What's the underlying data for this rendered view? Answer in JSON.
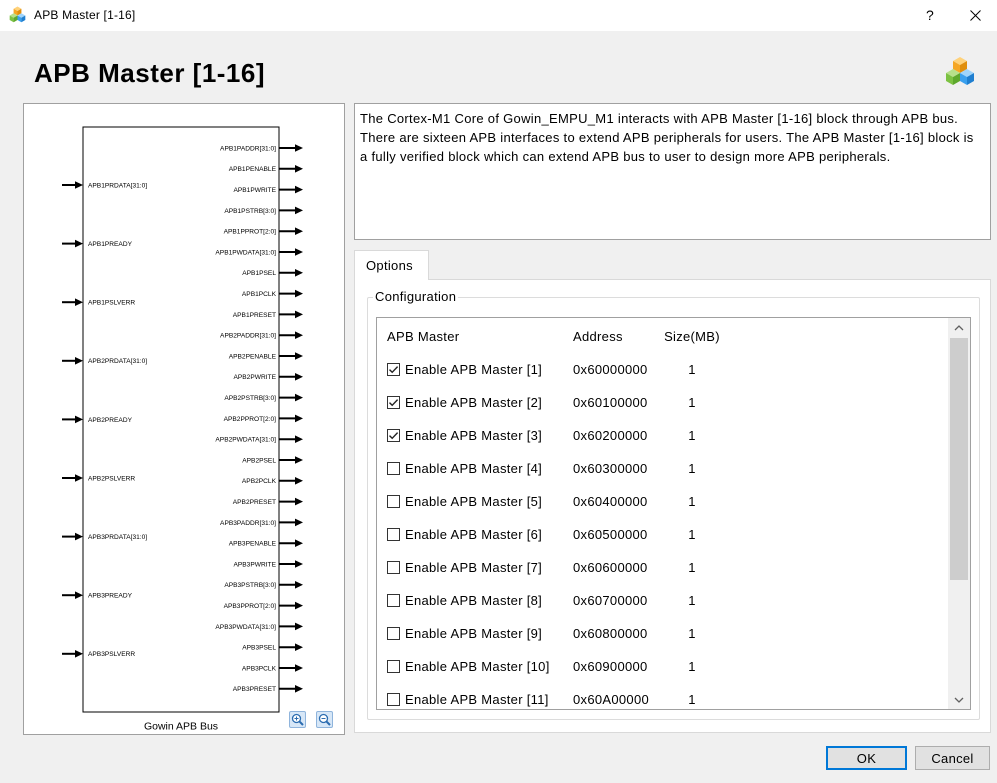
{
  "window": {
    "title": "APB Master [1-16]",
    "help_label": "?"
  },
  "header": {
    "title": "APB Master [1-16]"
  },
  "icons": {
    "app": "cube-stack-icon",
    "header": "cube-stack-icon",
    "close": "close-icon",
    "zoom_in": "zoom-in-icon",
    "zoom_out": "zoom-out-icon",
    "scroll_up": "chevron-up-icon",
    "scroll_down": "chevron-down-icon",
    "check": "checkmark-icon"
  },
  "colors": {
    "accent": "#0078d7"
  },
  "diagram": {
    "caption": "Gowin APB Bus",
    "inputs": [
      "APB1PRDATA[31:0]",
      "APB1PREADY",
      "APB1PSLVERR",
      "APB2PRDATA[31:0]",
      "APB2PREADY",
      "APB2PSLVERR",
      "APB3PRDATA[31:0]",
      "APB3PREADY",
      "APB3PSLVERR"
    ],
    "outputs": [
      "APB1PADDR[31:0]",
      "APB1PENABLE",
      "APB1PWRITE",
      "APB1PSTRB[3:0]",
      "APB1PPROT[2:0]",
      "APB1PWDATA[31:0]",
      "APB1PSEL",
      "APB1PCLK",
      "APB1PRESET",
      "APB2PADDR[31:0]",
      "APB2PENABLE",
      "APB2PWRITE",
      "APB2PSTRB[3:0]",
      "APB2PPROT[2:0]",
      "APB2PWDATA[31:0]",
      "APB2PSEL",
      "APB2PCLK",
      "APB2PRESET",
      "APB3PADDR[31:0]",
      "APB3PENABLE",
      "APB3PWRITE",
      "APB3PSTRB[3:0]",
      "APB3PPROT[2:0]",
      "APB3PWDATA[31:0]",
      "APB3PSEL",
      "APB3PCLK",
      "APB3PRESET"
    ]
  },
  "description": {
    "lines": [
      "The Cortex-M1 Core of Gowin_EMPU_M1 interacts with APB Master [1-16] block through APB bus.",
      "There are sixteen APB interfaces to extend APB peripherals for users. The APB Master [1-16] block is",
      "a fully verified block which can extend APB bus to user to design more APB peripherals."
    ]
  },
  "tabs": [
    {
      "label": "Options",
      "active": true
    }
  ],
  "configuration": {
    "legend": "Configuration",
    "columns": [
      "APB Master",
      "Address",
      "Size(MB)"
    ],
    "rows": [
      {
        "label": "Enable APB Master [1]",
        "checked": true,
        "address": "0x60000000",
        "size": "1"
      },
      {
        "label": "Enable APB Master [2]",
        "checked": true,
        "address": "0x60100000",
        "size": "1"
      },
      {
        "label": "Enable APB Master [3]",
        "checked": true,
        "address": "0x60200000",
        "size": "1"
      },
      {
        "label": "Enable APB Master [4]",
        "checked": false,
        "address": "0x60300000",
        "size": "1"
      },
      {
        "label": "Enable APB Master [5]",
        "checked": false,
        "address": "0x60400000",
        "size": "1"
      },
      {
        "label": "Enable APB Master [6]",
        "checked": false,
        "address": "0x60500000",
        "size": "1"
      },
      {
        "label": "Enable APB Master [7]",
        "checked": false,
        "address": "0x60600000",
        "size": "1"
      },
      {
        "label": "Enable APB Master [8]",
        "checked": false,
        "address": "0x60700000",
        "size": "1"
      },
      {
        "label": "Enable APB Master [9]",
        "checked": false,
        "address": "0x60800000",
        "size": "1"
      },
      {
        "label": "Enable APB Master [10]",
        "checked": false,
        "address": "0x60900000",
        "size": "1"
      },
      {
        "label": "Enable APB Master [11]",
        "checked": false,
        "address": "0x60A00000",
        "size": "1"
      }
    ]
  },
  "buttons": {
    "ok": "OK",
    "cancel": "Cancel"
  }
}
